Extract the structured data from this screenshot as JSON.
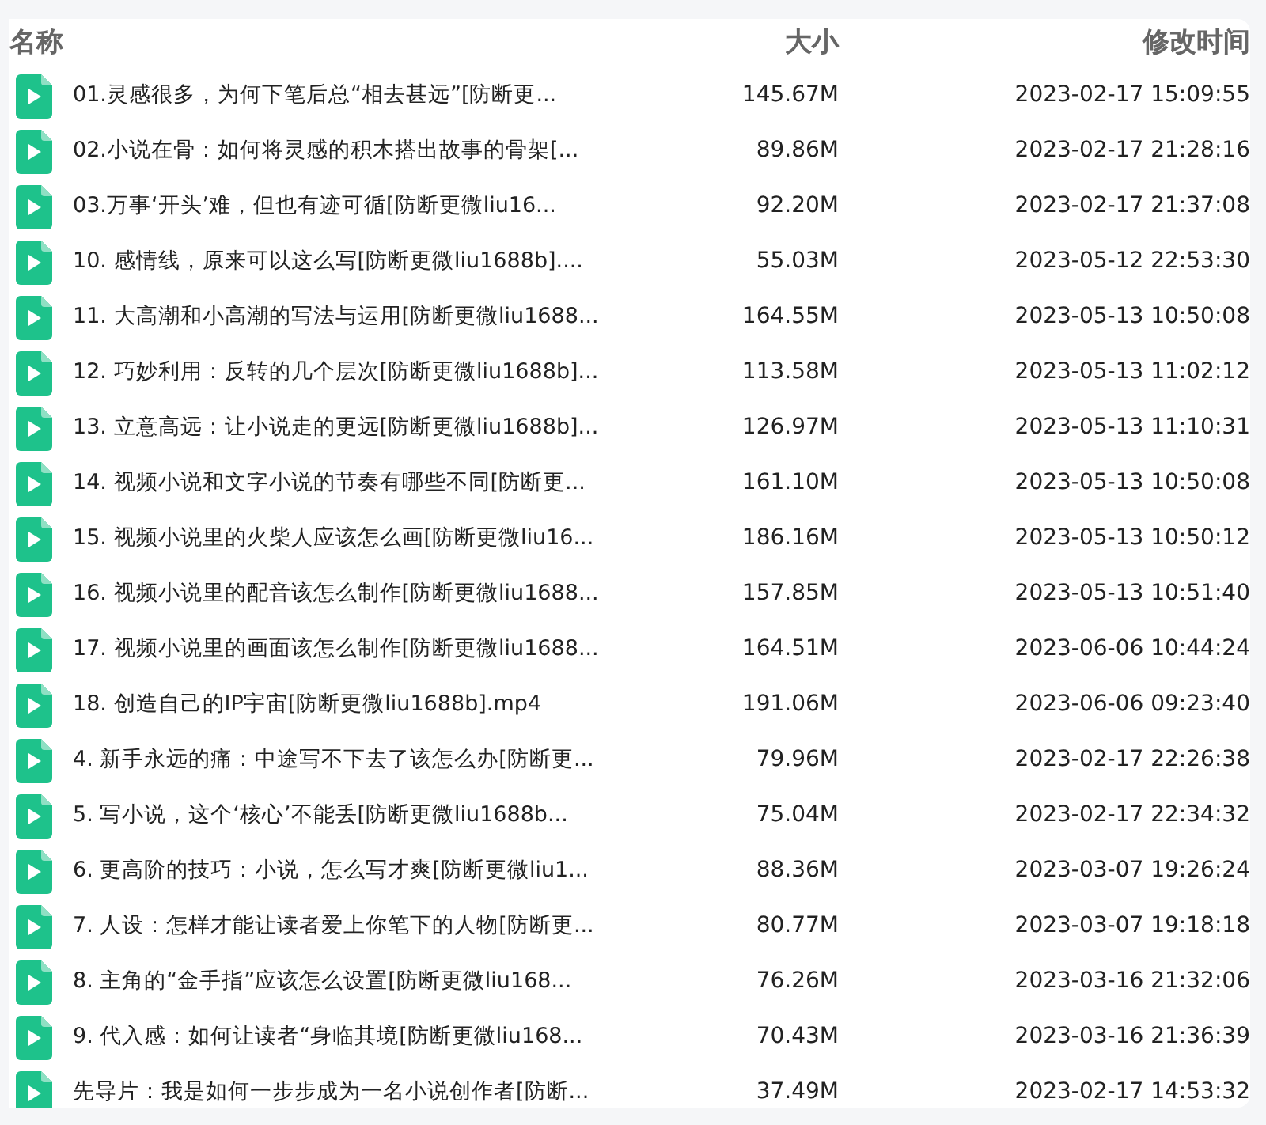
{
  "columns": [
    "名称",
    "大小",
    "修改时间"
  ],
  "files": [
    {
      "name": "01.灵感很多，为何下笔后总“相去甚远”[防断更...",
      "size": "145.67M",
      "modified": "2023-02-17 15:09:55"
    },
    {
      "name": "02.小说在骨：如何将灵感的积木搭出故事的骨架[...",
      "size": "89.86M",
      "modified": "2023-02-17 21:28:16"
    },
    {
      "name": "03.万事‘开头’难，但也有迹可循[防断更微liu16...",
      "size": "92.20M",
      "modified": "2023-02-17 21:37:08"
    },
    {
      "name": "10. 感情线，原来可以这么写[防断更微liu1688b]....",
      "size": "55.03M",
      "modified": "2023-05-12 22:53:30"
    },
    {
      "name": "11. 大高潮和小高潮的写法与运用[防断更微liu1688...",
      "size": "164.55M",
      "modified": "2023-05-13 10:50:08"
    },
    {
      "name": "12. 巧妙利用：反转的几个层次[防断更微liu1688b]...",
      "size": "113.58M",
      "modified": "2023-05-13 11:02:12"
    },
    {
      "name": "13. 立意高远：让小说走的更远[防断更微liu1688b]...",
      "size": "126.97M",
      "modified": "2023-05-13 11:10:31"
    },
    {
      "name": "14. 视频小说和文字小说的节奏有哪些不同[防断更...",
      "size": "161.10M",
      "modified": "2023-05-13 10:50:08"
    },
    {
      "name": "15. 视频小说里的火柴人应该怎么画[防断更微liu16...",
      "size": "186.16M",
      "modified": "2023-05-13 10:50:12"
    },
    {
      "name": "16. 视频小说里的配音该怎么制作[防断更微liu1688...",
      "size": "157.85M",
      "modified": "2023-05-13 10:51:40"
    },
    {
      "name": "17. 视频小说里的画面该怎么制作[防断更微liu1688...",
      "size": "164.51M",
      "modified": "2023-06-06 10:44:24"
    },
    {
      "name": "18. 创造自己的IP宇宙[防断更微liu1688b].mp4",
      "size": "191.06M",
      "modified": "2023-06-06 09:23:40"
    },
    {
      "name": "4. 新手永远的痛：中途写不下去了该怎么办[防断更...",
      "size": "79.96M",
      "modified": "2023-02-17 22:26:38"
    },
    {
      "name": "5. 写小说，这个‘核心’不能丢[防断更微liu1688b...",
      "size": "75.04M",
      "modified": "2023-02-17 22:34:32"
    },
    {
      "name": "6. 更高阶的技巧：小说，怎么写才爽[防断更微liu1...",
      "size": "88.36M",
      "modified": "2023-03-07 19:26:24"
    },
    {
      "name": "7. 人设：怎样才能让读者爱上你笔下的人物[防断更...",
      "size": "80.77M",
      "modified": "2023-03-07 19:18:18"
    },
    {
      "name": "8. 主角的“金手指”应该怎么设置[防断更微liu168...",
      "size": "76.26M",
      "modified": "2023-03-16 21:32:06"
    },
    {
      "name": "9. 代入感：如何让读者“身临其境[防断更微liu168...",
      "size": "70.43M",
      "modified": "2023-03-16 21:36:39"
    },
    {
      "name": "先导片：我是如何一步步成为一名小说创作者[防断...",
      "size": "37.49M",
      "modified": "2023-02-17 14:53:32"
    }
  ]
}
